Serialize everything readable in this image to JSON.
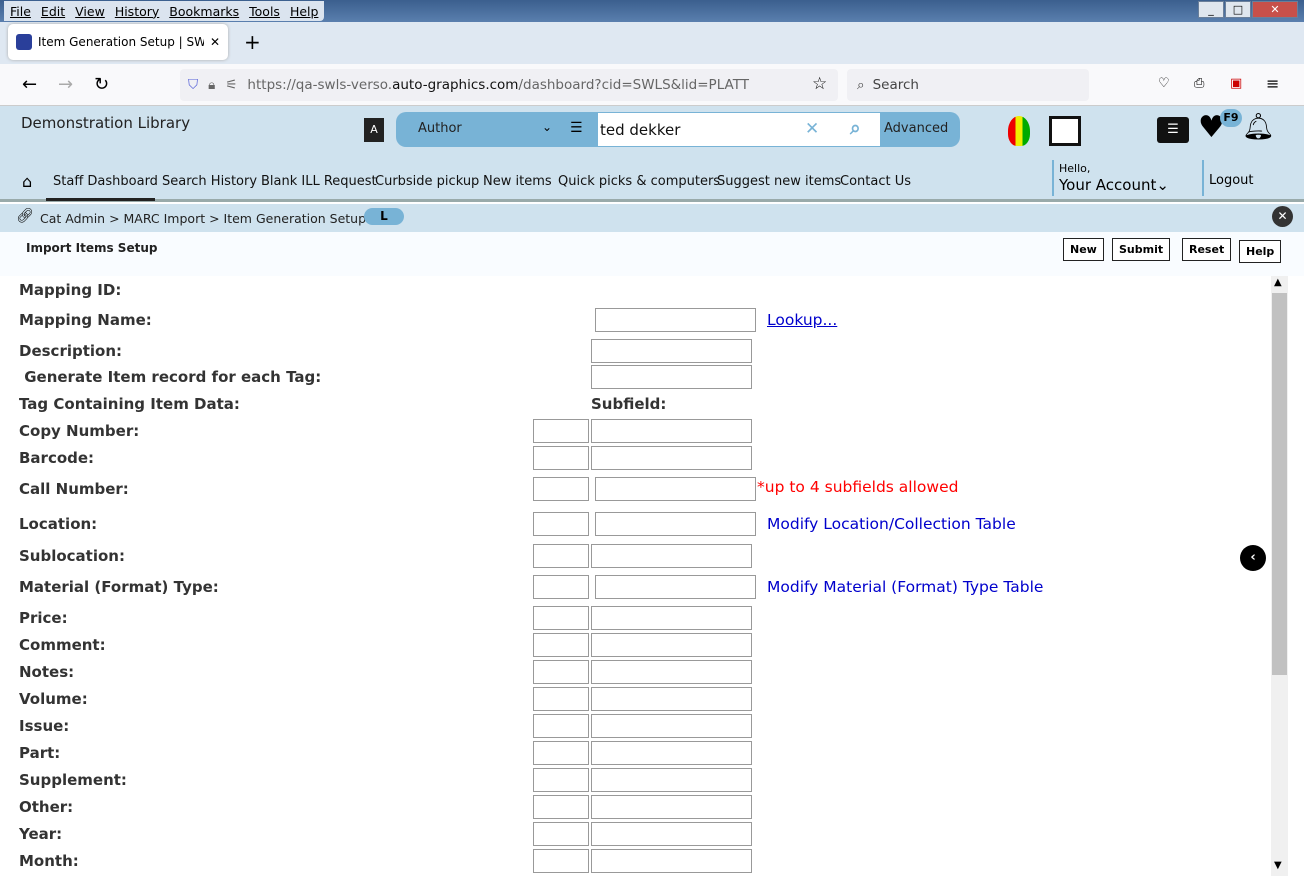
{
  "browser": {
    "menu": [
      "File",
      "Edit",
      "View",
      "History",
      "Bookmarks",
      "Tools",
      "Help"
    ],
    "tab_title": "Item Generation Setup | SWLS | ",
    "url_prefix": "https://qa-swls-verso.",
    "url_domain": "auto-graphics.com",
    "url_path": "/dashboard?cid=SWLS&lid=PLATT",
    "search_placeholder": "Search"
  },
  "header": {
    "library": "Demonstration Library",
    "search_type": "Author",
    "search_value": "ted dekker",
    "advanced": "Advanced",
    "badge": "F9",
    "nav": [
      "Staff Dashboard",
      "Search History",
      "Blank ILL Request",
      "Curbside pickup",
      "New items",
      "Quick picks & computers",
      "Suggest new items",
      "Contact Us"
    ],
    "hello": "Hello,",
    "account": "Your Account",
    "logout": "Logout"
  },
  "breadcrumb": {
    "text": "Cat Admin > MARC Import > Item Generation Setup",
    "pill": "L"
  },
  "page": {
    "title": "Import Items Setup",
    "buttons": [
      "New",
      "Submit",
      "Reset",
      "Help"
    ],
    "subfield_header": "Subfield:",
    "rows": [
      {
        "label": "Mapping ID:"
      },
      {
        "label": "Mapping Name:",
        "link": "Lookup..."
      },
      {
        "label": "Description:"
      },
      {
        "label": " Generate Item record for each Tag:"
      },
      {
        "label": "Tag Containing Item Data:"
      },
      {
        "label": "Copy Number:"
      },
      {
        "label": "Barcode:"
      },
      {
        "label": "Call Number:",
        "note": "*up to 4 subfields allowed"
      },
      {
        "label": "Location:",
        "link": "Modify Location/Collection Table"
      },
      {
        "label": "Sublocation:"
      },
      {
        "label": "Material (Format) Type:",
        "link": "Modify Material (Format) Type Table"
      },
      {
        "label": "Price:"
      },
      {
        "label": "Comment:"
      },
      {
        "label": "Notes:"
      },
      {
        "label": "Volume:"
      },
      {
        "label": "Issue:"
      },
      {
        "label": "Part:"
      },
      {
        "label": "Supplement:"
      },
      {
        "label": "Other:"
      },
      {
        "label": "Year:"
      },
      {
        "label": "Month:"
      }
    ]
  },
  "colors": {
    "header_bg": "#cfe2ee",
    "search_bar": "#78b3d6",
    "link": "#0000cc",
    "note": "#ff0000"
  }
}
